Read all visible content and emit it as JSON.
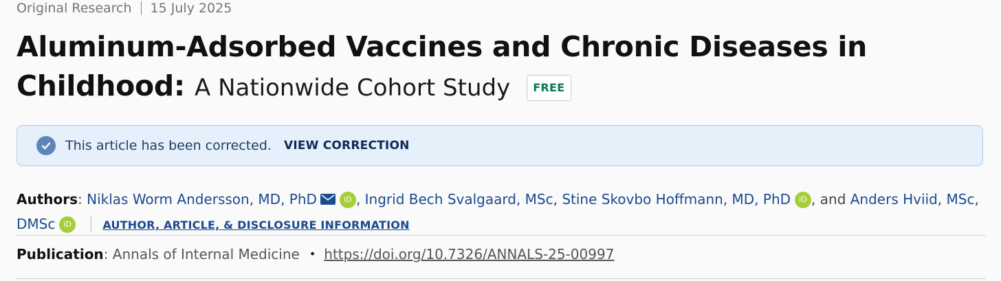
{
  "meta": {
    "article_type": "Original Research",
    "date": "15 July 2025"
  },
  "title": {
    "main": "Aluminum-Adsorbed Vaccines and Chronic Diseases in Childhood:",
    "subtitle": "A Nationwide Cohort Study",
    "badge": "FREE"
  },
  "notice": {
    "icon": "check-circle-icon",
    "text": "This article has been corrected.",
    "link": "VIEW CORRECTION"
  },
  "authors": {
    "label": "Authors",
    "colon": ": ",
    "list": [
      {
        "name": "Niklas Worm Andersson, MD, PhD"
      },
      {
        "name": "Ingrid Bech Svalgaard, MSc"
      },
      {
        "name": "Stine Skovbo Hoffmann, MD, PhD"
      },
      {
        "name": "Anders Hviid, MSc, DMSc"
      }
    ],
    "comma": ", ",
    "and_text": ", and ",
    "orcid_text": "iD",
    "info_link": "AUTHOR, ARTICLE, & DISCLOSURE INFORMATION"
  },
  "publication": {
    "label": "Publication",
    "colon": ": ",
    "journal": "Annals of Internal Medicine",
    "bullet": "•",
    "doi": "https://doi.org/10.7326/ANNALS-25-00997"
  },
  "colors": {
    "author_link": "#1a4a8f",
    "free_badge": "#0b7a52",
    "notice_bg": "#e6f0fb",
    "orcid": "#a6ce39"
  }
}
